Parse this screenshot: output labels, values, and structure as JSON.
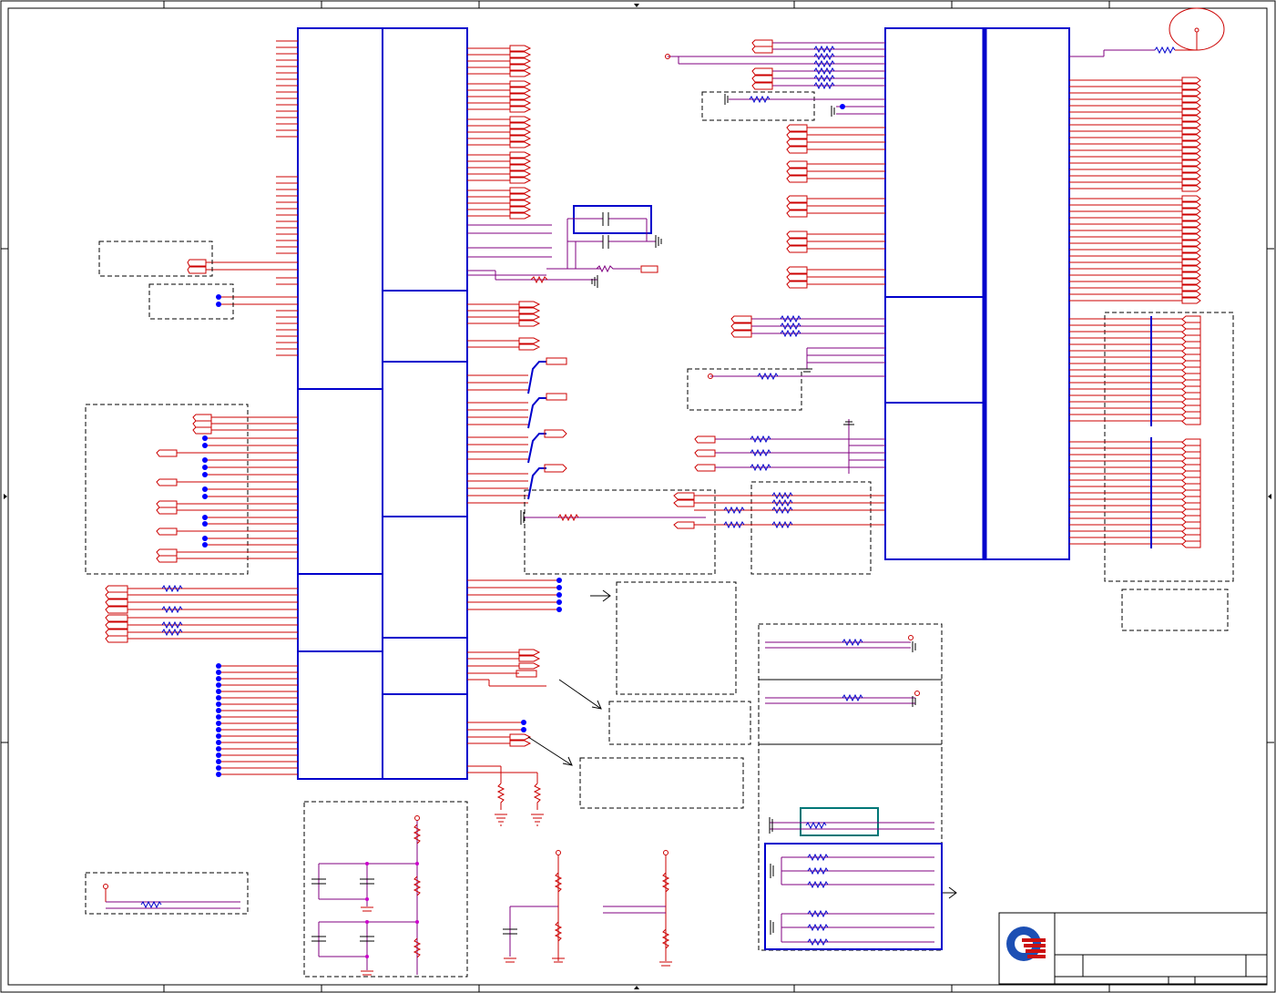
{
  "sheet": {
    "title": "",
    "logo": "quanta-logo",
    "colors": {
      "border": "#000000",
      "block": "#0000cc",
      "wire": "#cc0000",
      "net": "#800080",
      "dashed": "#000000",
      "highlight": "#007777"
    }
  }
}
